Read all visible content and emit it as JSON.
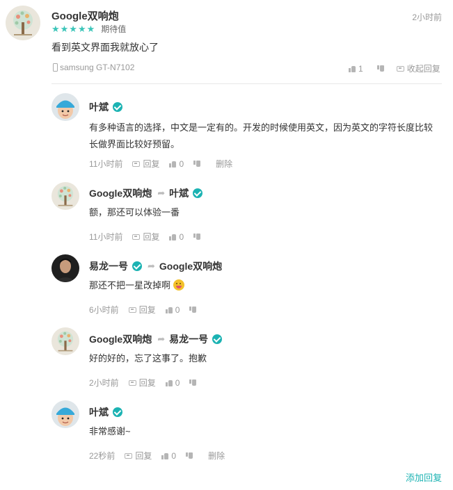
{
  "main_comment": {
    "author": "Google双响炮",
    "stars": "★★★★★",
    "rating_label": "期待值",
    "time": "2小时前",
    "text": "看到英文界面我就放心了",
    "device": "samsung GT-N7102",
    "like_count": "1",
    "collapse_label": "收起回复"
  },
  "replies": [
    {
      "author": "叶斌",
      "target": "",
      "text": "有多种语言的选择，中文是一定有的。开发的时候使用英文，因为英文的字符长度比较长做界面比较好预留。",
      "time": "11小时前",
      "reply_label": "回复",
      "like_count": "0",
      "delete_label": "删除"
    },
    {
      "author": "Google双响炮",
      "target": "叶斌",
      "text": "额，那还可以体验一番",
      "time": "11小时前",
      "reply_label": "回复",
      "like_count": "0"
    },
    {
      "author": "易龙一号",
      "target": "Google双响炮",
      "text": "那还不把一星改掉啊",
      "time": "6小时前",
      "reply_label": "回复",
      "like_count": "0"
    },
    {
      "author": "Google双响炮",
      "target": "易龙一号",
      "text": "好的好的，忘了这事了。抱歉",
      "time": "2小时前",
      "reply_label": "回复",
      "like_count": "0"
    },
    {
      "author": "叶斌",
      "target": "",
      "text": "非常感谢~",
      "time": "22秒前",
      "reply_label": "回复",
      "like_count": "0",
      "delete_label": "删除"
    }
  ],
  "add_reply_label": "添加回复",
  "colors": {
    "accent": "#1cb3b3",
    "star": "#3cc5b9",
    "muted": "#999999"
  }
}
